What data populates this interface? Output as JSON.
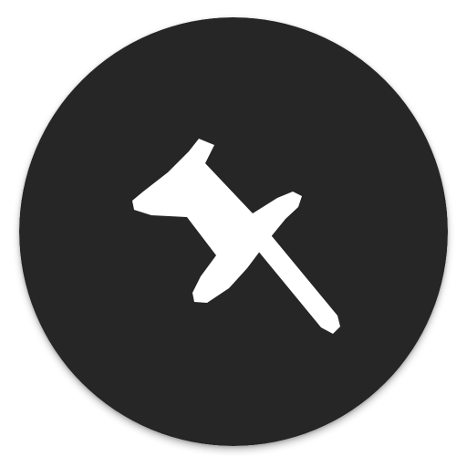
{
  "app_icon": {
    "icon": "pushpin-icon",
    "background_color": "#262626",
    "icon_color": "#ffffff"
  }
}
